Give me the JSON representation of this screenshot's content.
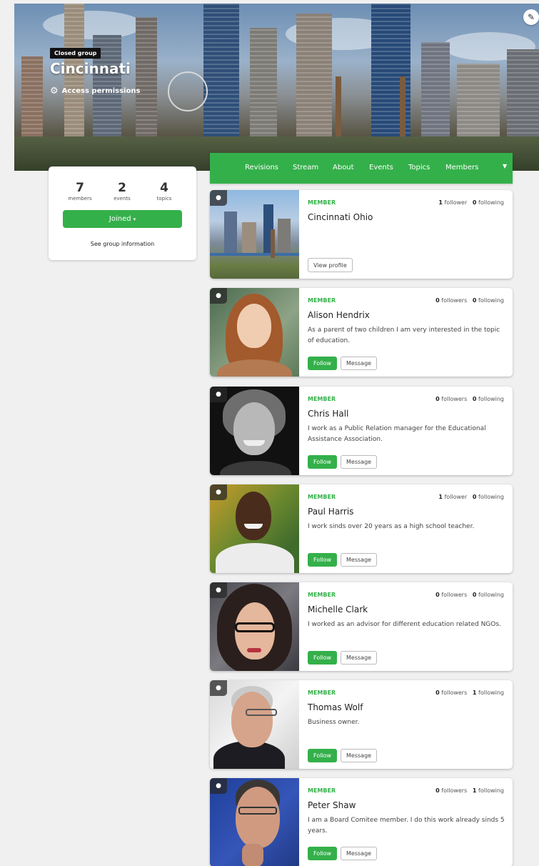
{
  "group": {
    "badge": "Closed group",
    "name": "Cincinnati",
    "access_label": "Access permissions"
  },
  "stats": [
    {
      "value": "7",
      "label": "members"
    },
    {
      "value": "2",
      "label": "events"
    },
    {
      "value": "4",
      "label": "topics"
    }
  ],
  "joined_label": "Joined",
  "see_info_label": "See group information",
  "nav": [
    "Revisions",
    "Stream",
    "About",
    "Events",
    "Topics",
    "Members"
  ],
  "members": [
    {
      "role": "MEMBER",
      "name": "Cincinnati Ohio",
      "bio": "",
      "followers": "1",
      "followers_label": "follower",
      "following": "0",
      "following_label": "following",
      "button": "View profile"
    },
    {
      "role": "MEMBER",
      "name": "Alison Hendrix",
      "bio": "As a parent of two children I am very interested in the topic of education.",
      "followers": "0",
      "followers_label": "followers",
      "following": "0",
      "following_label": "following",
      "follow": "Follow",
      "message": "Message"
    },
    {
      "role": "MEMBER",
      "name": "Chris Hall",
      "bio": "I work as a Public Relation manager for the Educational Assistance Association.",
      "followers": "0",
      "followers_label": "followers",
      "following": "0",
      "following_label": "following",
      "follow": "Follow",
      "message": "Message"
    },
    {
      "role": "MEMBER",
      "name": "Paul Harris",
      "bio": "I work sinds over 20 years as a high school teacher.",
      "followers": "1",
      "followers_label": "follower",
      "following": "0",
      "following_label": "following",
      "follow": "Follow",
      "message": "Message"
    },
    {
      "role": "MEMBER",
      "name": "Michelle Clark",
      "bio": "I worked as an advisor for different education related NGOs.",
      "followers": "0",
      "followers_label": "followers",
      "following": "0",
      "following_label": "following",
      "follow": "Follow",
      "message": "Message"
    },
    {
      "role": "MEMBER",
      "name": "Thomas Wolf",
      "bio": "Business owner.",
      "followers": "0",
      "followers_label": "followers",
      "following": "1",
      "following_label": "following",
      "follow": "Follow",
      "message": "Message"
    },
    {
      "role": "MEMBER",
      "name": "Peter Shaw",
      "bio": "I am a Board Comitee member. I do this work already sinds 5 years.",
      "followers": "0",
      "followers_label": "followers",
      "following": "1",
      "following_label": "following",
      "follow": "Follow",
      "message": "Message"
    }
  ],
  "colors": {
    "accent": "#34b04a",
    "background": "#f0f0f0"
  },
  "icons": {
    "edit": "pencil-icon",
    "access": "gear-icon",
    "member": "user-icon",
    "caret": "caret-down-icon"
  }
}
